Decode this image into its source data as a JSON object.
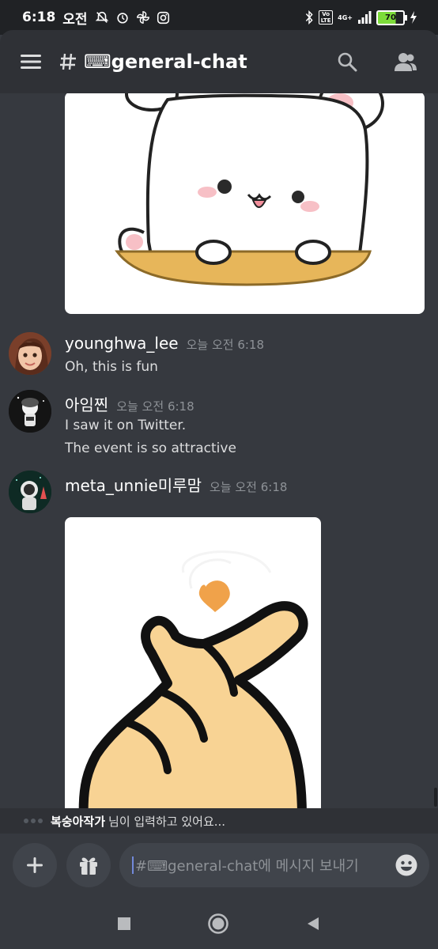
{
  "status_bar": {
    "time": "6:18",
    "ampm": "오전",
    "network_label": "4G+",
    "volte_label": "Vo LTE",
    "battery": "70"
  },
  "header": {
    "channel_name": "⌨general-chat",
    "icons": [
      "menu-icon",
      "hash-icon",
      "search-icon",
      "members-icon"
    ]
  },
  "messages": [
    {
      "username": "younghwa_lee",
      "timestamp": "오늘 오전 6:18",
      "lines": [
        "Oh, this is fun"
      ]
    },
    {
      "username": "아임찐",
      "timestamp": "오늘 오전 6:18",
      "lines": [
        "I saw it on Twitter.",
        "The event is so attractive"
      ]
    },
    {
      "username": "meta_unnie미루맘",
      "timestamp": "오늘 오전 6:18",
      "lines": []
    }
  ],
  "typing": {
    "user": "복숭아작가",
    "text": "님이 입력하고 있어요..."
  },
  "composer": {
    "placeholder": "#⌨general-chat에 메시지 보내기",
    "icons": [
      "plus-icon",
      "gift-icon",
      "emoji-icon"
    ]
  },
  "colors": {
    "background": "#36393f",
    "header": "#2f3136",
    "input": "#40444b",
    "accent": "#7289da"
  }
}
